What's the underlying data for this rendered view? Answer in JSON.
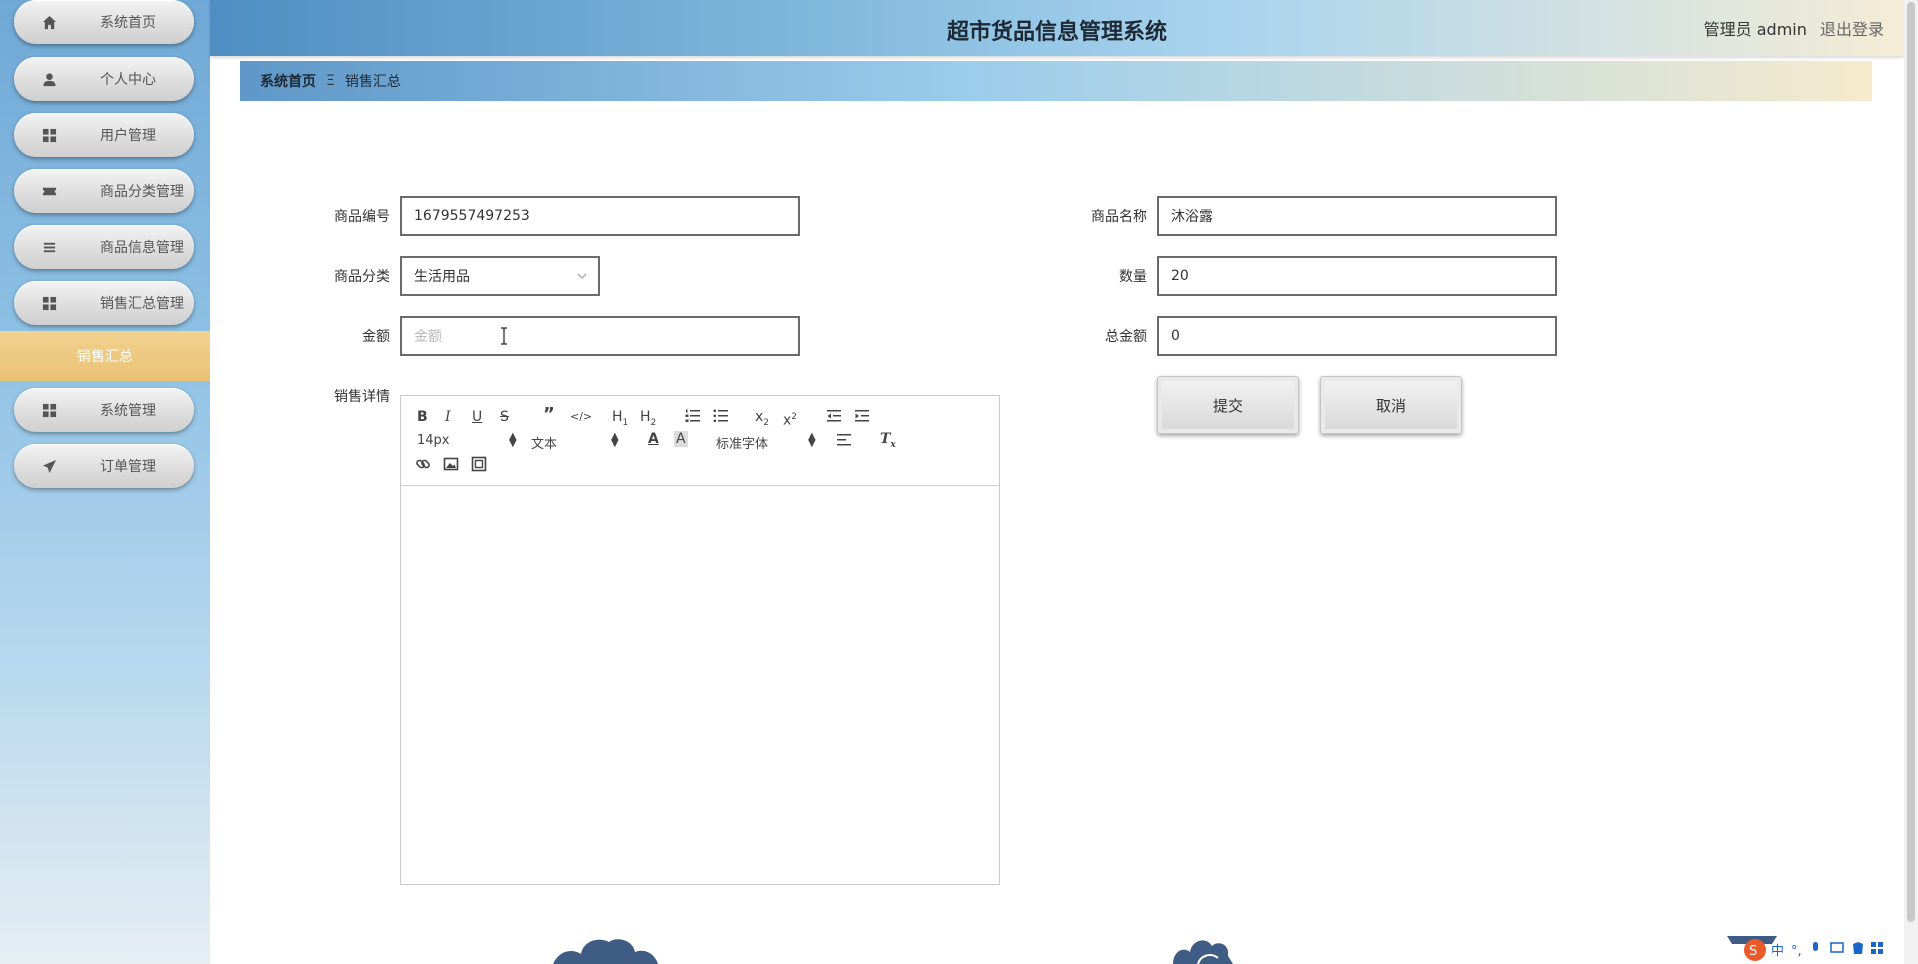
{
  "app": {
    "title": "超市货品信息管理系统"
  },
  "header": {
    "user_label": "管理员 admin",
    "logout_label": "退出登录"
  },
  "sidebar": {
    "items": [
      {
        "label": "系统首页",
        "icon": "home-icon"
      },
      {
        "label": "个人中心",
        "icon": "user-icon"
      },
      {
        "label": "用户管理",
        "icon": "grid-icon"
      },
      {
        "label": "商品分类管理",
        "icon": "ticket-icon"
      },
      {
        "label": "商品信息管理",
        "icon": "list-icon"
      },
      {
        "label": "销售汇总管理",
        "icon": "grid-icon"
      },
      {
        "label": "系统管理",
        "icon": "grid-icon"
      },
      {
        "label": "订单管理",
        "icon": "send-icon"
      }
    ],
    "active_sub": "销售汇总"
  },
  "breadcrumb": {
    "home": "系统首页",
    "separator": "Ξ",
    "current": "销售汇总"
  },
  "form": {
    "product_code": {
      "label": "商品编号",
      "value": "1679557497253"
    },
    "product_name": {
      "label": "商品名称",
      "value": "沐浴露"
    },
    "category": {
      "label": "商品分类",
      "value": "生活用品"
    },
    "quantity": {
      "label": "数量",
      "value": "20"
    },
    "amount": {
      "label": "金额",
      "value": "",
      "placeholder": "金额"
    },
    "total": {
      "label": "总金额",
      "value": "0"
    },
    "details": {
      "label": "销售详情"
    },
    "submit_label": "提交",
    "cancel_label": "取消"
  },
  "editor": {
    "font_size": "14px",
    "text_style": "文本",
    "font_family": "标准字体"
  },
  "colors": {
    "accent_gold": "#e9c277",
    "header_blue": "#4f8ec2"
  }
}
